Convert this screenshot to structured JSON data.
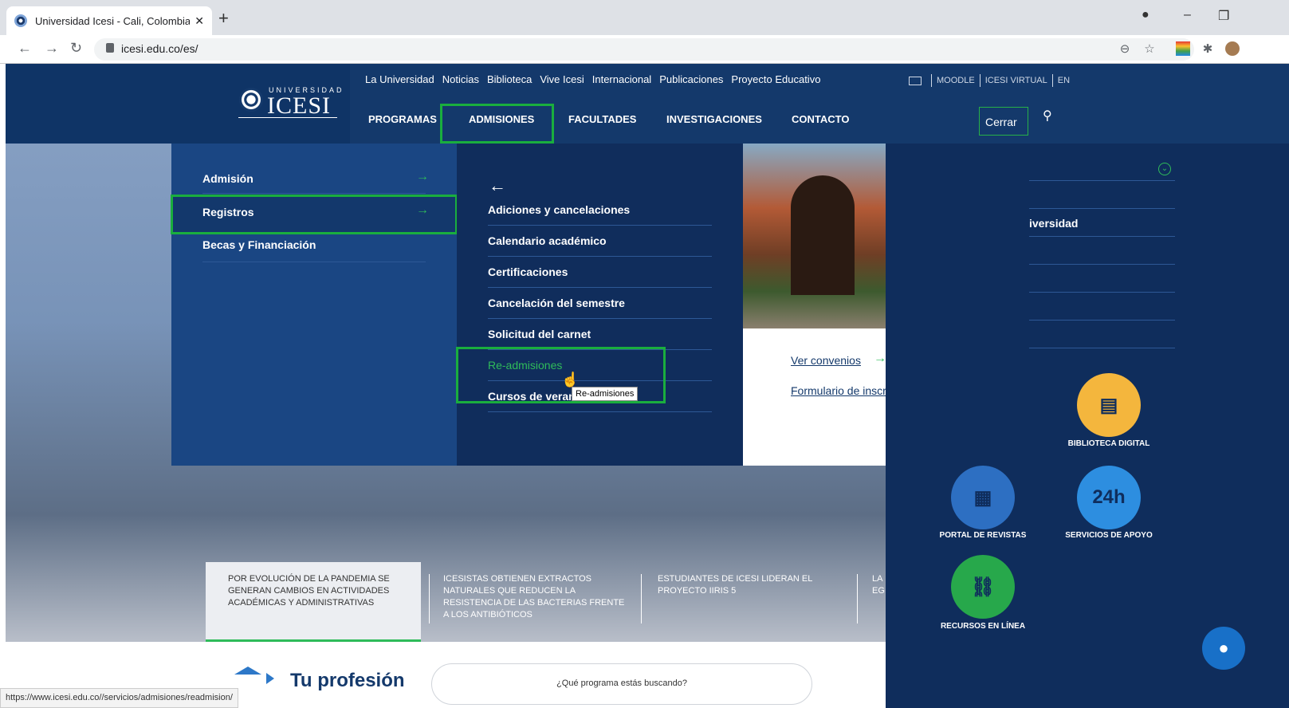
{
  "browser": {
    "tab_title": "Universidad Icesi - Cali, Colombia",
    "url": "icesi.edu.co/es/",
    "status_url": "https://www.icesi.edu.co//servicios/admisiones/readmision/"
  },
  "header": {
    "logo_top": "UNIVERSIDAD",
    "logo_name": "ICESI",
    "top_links": [
      "La Universidad",
      "Noticias",
      "Biblioteca",
      "Vive Icesi",
      "Internacional",
      "Publicaciones",
      "Proyecto Educativo"
    ],
    "utils": [
      "MOODLE",
      "ICESI VIRTUAL",
      "EN"
    ],
    "main_nav": [
      "PROGRAMAS",
      "ADMISIONES",
      "FACULTADES",
      "INVESTIGACIONES",
      "CONTACTO"
    ],
    "close": "Cerrar"
  },
  "menu": {
    "col1": [
      "Admisión",
      "Registros",
      "Becas y Financiación"
    ],
    "col2": [
      "Adiciones y cancelaciones",
      "Calendario académico",
      "Certificaciones",
      "Cancelación del semestre",
      "Solicitud del carnet",
      "Re-admisiones",
      "Cursos de verano"
    ],
    "tooltip": "Re-admisiones",
    "col3_links": [
      "Ver convenios",
      "Formulario de inscripción"
    ]
  },
  "sidebar": {
    "partial_text": "iversidad",
    "items": [
      "BIBLIOTECA DIGITAL",
      "PORTAL DE REVISTAS",
      "SERVICIOS DE APOYO",
      "RECURSOS EN LÍNEA"
    ]
  },
  "news": [
    "POR EVOLUCIÓN DE LA PANDEMIA SE GENERAN CAMBIOS EN ACTIVIDADES ACADÉMICAS Y ADMINISTRATIVAS",
    "ICESISTAS OBTIENEN EXTRACTOS NATURALES QUE REDUCEN LA RESISTENCIA DE LAS BACTERIAS FRENTE A LOS ANTIBIÓTICOS",
    "ESTUDIANTES DE ICESI LIDERAN EL PROYECTO IIRIS 5",
    "LA EG"
  ],
  "footer": {
    "title": "Tu profesión",
    "search_placeholder": "¿Qué programa estás buscando?"
  },
  "colors": {
    "navy": "#14396b",
    "highlight": "#1aae3e",
    "green_arrow": "#2fbb5a"
  }
}
